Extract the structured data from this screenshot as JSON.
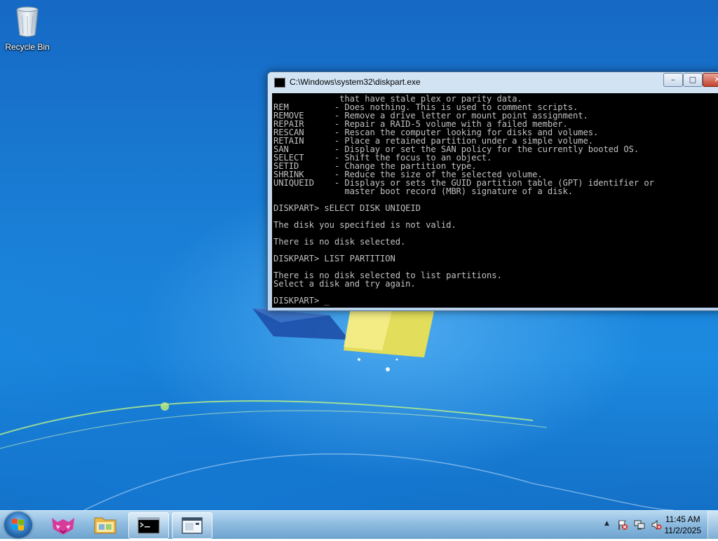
{
  "desktop": {
    "icons": [
      {
        "label": "Recycle Bin",
        "icon": "recycle-bin-icon"
      }
    ]
  },
  "console_window": {
    "title": "C:\\Windows\\system32\\diskpart.exe",
    "buttons": {
      "minimize": "–",
      "maximize": "□",
      "close": "✕"
    },
    "background": "#000000",
    "foreground": "#c0c0c0",
    "lines": [
      "             that have stale plex or parity data.",
      "REM         - Does nothing. This is used to comment scripts.",
      "REMOVE      - Remove a drive letter or mount point assignment.",
      "REPAIR      - Repair a RAID-5 volume with a failed member.",
      "RESCAN      - Rescan the computer looking for disks and volumes.",
      "RETAIN      - Place a retained partition under a simple volume.",
      "SAN         - Display or set the SAN policy for the currently booted OS.",
      "SELECT      - Shift the focus to an object.",
      "SETID       - Change the partition type.",
      "SHRINK      - Reduce the size of the selected volume.",
      "UNIQUEID    - Displays or sets the GUID partition table (GPT) identifier or",
      "              master boot record (MBR) signature of a disk.",
      "",
      "DISKPART> sELECT DISK UNIQEID",
      "",
      "The disk you specified is not valid.",
      "",
      "There is no disk selected.",
      "",
      "DISKPART> LIST PARTITION",
      "",
      "There is no disk selected to list partitions.",
      "Select a disk and try again.",
      ""
    ],
    "prompt": "DISKPART> ",
    "cursor": "_"
  },
  "taskbar": {
    "apps": [
      {
        "name": "start",
        "icon": "windows-logo-icon"
      },
      {
        "name": "app-fox",
        "icon": "fox-app-icon"
      },
      {
        "name": "explorer",
        "icon": "folder-icon"
      },
      {
        "name": "cmd",
        "icon": "command-prompt-icon",
        "active": true
      },
      {
        "name": "window",
        "icon": "window-app-icon",
        "active": true
      }
    ],
    "tray": {
      "show_hidden": "▲",
      "icons": [
        "flag-error-icon",
        "network-icon",
        "volume-muted-icon"
      ]
    },
    "clock": {
      "time": "11:45 AM",
      "date": "11/2/2025"
    }
  }
}
